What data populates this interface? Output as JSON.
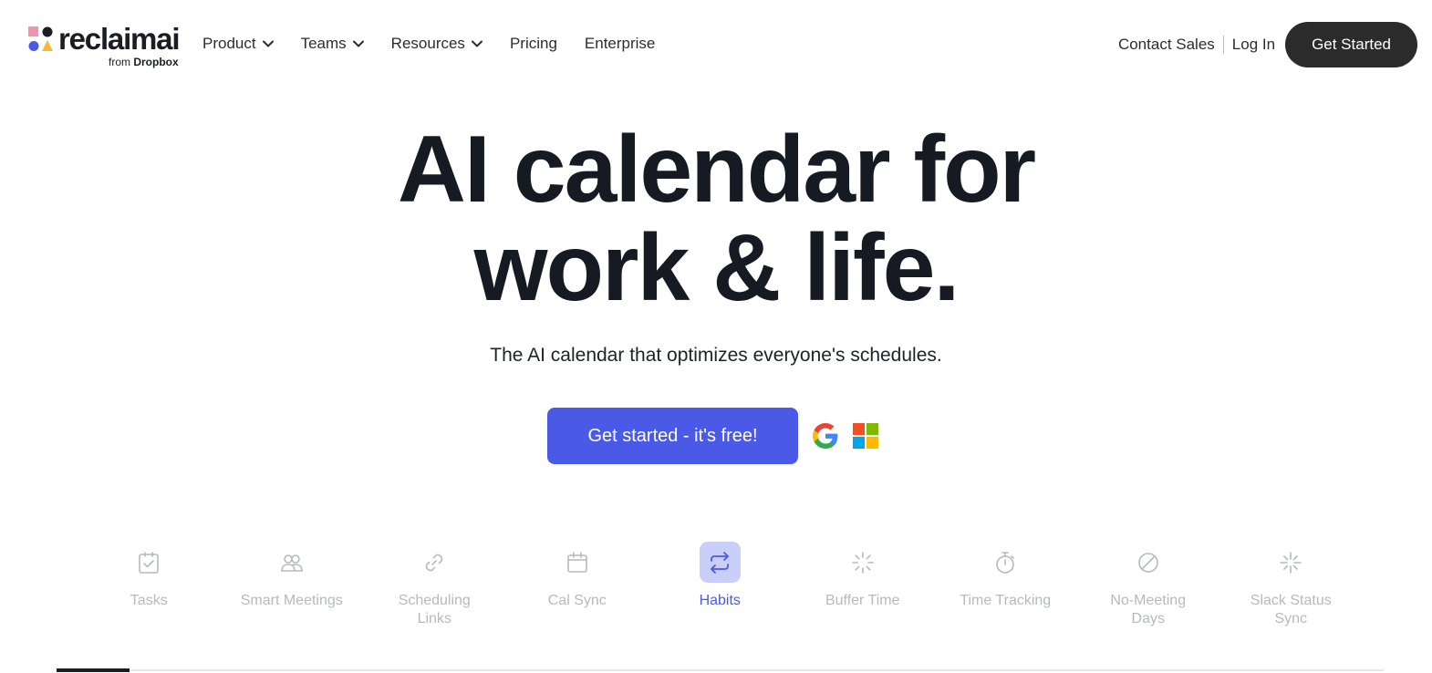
{
  "brand": {
    "name": "reclaimai",
    "sub_prefix": "from",
    "sub_brand": "Dropbox",
    "colors": {
      "pink": "#f294b0",
      "dark": "#1a1d23",
      "blue": "#4b5ae6",
      "yellow": "#f6b83c"
    }
  },
  "nav": {
    "items": [
      {
        "label": "Product",
        "has_dropdown": true
      },
      {
        "label": "Teams",
        "has_dropdown": true
      },
      {
        "label": "Resources",
        "has_dropdown": true
      },
      {
        "label": "Pricing",
        "has_dropdown": false
      },
      {
        "label": "Enterprise",
        "has_dropdown": false
      }
    ],
    "contact_sales": "Contact Sales",
    "login": "Log In",
    "get_started": "Get Started"
  },
  "hero": {
    "title_line1": "AI calendar for",
    "title_line2": "work & life.",
    "subtitle": "The AI calendar that optimizes everyone's schedules.",
    "cta_label": "Get started - it's free!",
    "providers": [
      "google-icon",
      "microsoft-icon"
    ]
  },
  "features": {
    "active_index": 4,
    "items": [
      {
        "label": "Tasks",
        "icon": "task-check-icon"
      },
      {
        "label": "Smart Meetings",
        "icon": "people-icon"
      },
      {
        "label": "Scheduling Links",
        "icon": "link-icon"
      },
      {
        "label": "Cal Sync",
        "icon": "calendar-icon"
      },
      {
        "label": "Habits",
        "icon": "repeat-icon"
      },
      {
        "label": "Buffer Time",
        "icon": "loader-icon"
      },
      {
        "label": "Time Tracking",
        "icon": "stopwatch-icon"
      },
      {
        "label": "No-Meeting Days",
        "icon": "no-entry-icon"
      },
      {
        "label": "Slack Status Sync",
        "icon": "sparkle-icon"
      }
    ]
  },
  "colors": {
    "accent": "#4b5ae6",
    "accent_soft": "#c9cff8",
    "dark_button": "#2b2b2b",
    "inactive_text": "#b7b9bd"
  }
}
